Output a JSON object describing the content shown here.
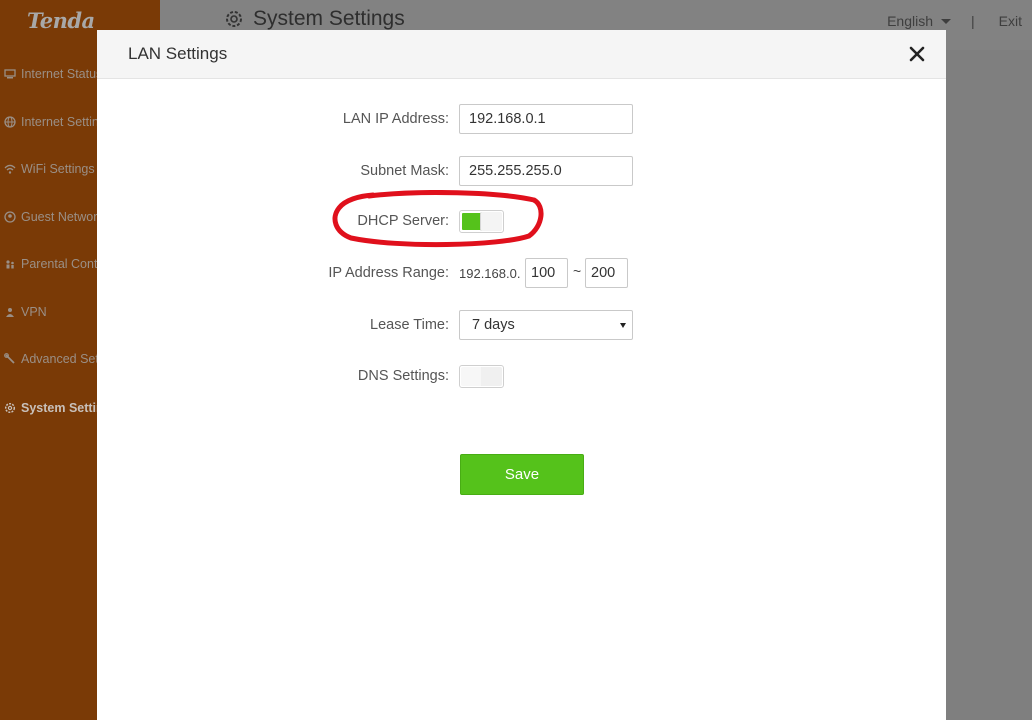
{
  "brand": {
    "logo": "Tenda"
  },
  "sidebar": {
    "items": [
      {
        "label": "Internet Status",
        "icon": "monitor-icon"
      },
      {
        "label": "Internet Settings",
        "icon": "globe-icon"
      },
      {
        "label": "WiFi Settings",
        "icon": "wifi-icon"
      },
      {
        "label": "Guest Network",
        "icon": "guest-icon"
      },
      {
        "label": "Parental Control",
        "icon": "parental-icon"
      },
      {
        "label": "VPN",
        "icon": "vpn-icon"
      },
      {
        "label": "Advanced Settings",
        "icon": "wrench-icon"
      },
      {
        "label": "System Settings",
        "icon": "gear-icon"
      }
    ],
    "active_index": 7
  },
  "header": {
    "title": "System Settings",
    "language": "English",
    "separator": "|",
    "exit": "Exit"
  },
  "modal": {
    "title": "LAN Settings",
    "fields": {
      "lan_ip": {
        "label": "LAN IP Address:",
        "value": "192.168.0.1"
      },
      "subnet_mask": {
        "label": "Subnet Mask:",
        "value": "255.255.255.0"
      },
      "dhcp_server": {
        "label": "DHCP Server:",
        "enabled": true
      },
      "ip_range": {
        "label": "IP Address Range:",
        "prefix": "192.168.0.",
        "start": "100",
        "separator": "~",
        "end": "200"
      },
      "lease_time": {
        "label": "Lease Time:",
        "value": "7 days"
      },
      "dns_settings": {
        "label": "DNS Settings:",
        "enabled": false
      }
    },
    "save_label": "Save"
  },
  "colors": {
    "accent_green": "#55c21b",
    "sidebar_orange_dimmed": "#7a3a06",
    "annotation_red": "#e0101c"
  }
}
